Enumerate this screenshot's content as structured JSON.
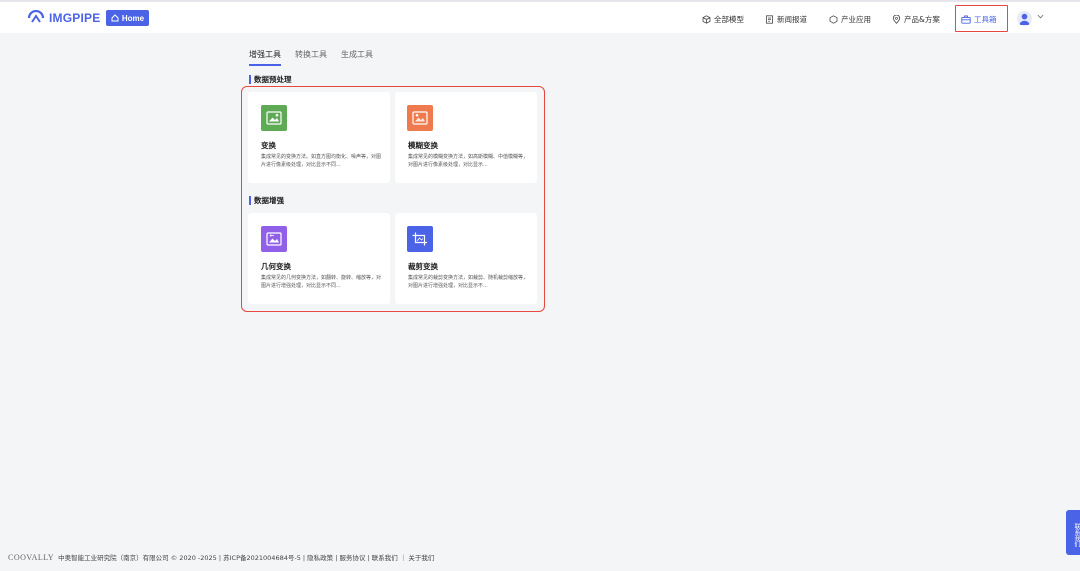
{
  "header": {
    "logo_text": "IMGPIPE",
    "home_label": "Home",
    "nav": [
      {
        "label": "全部模型",
        "icon": "cube-icon"
      },
      {
        "label": "新闻报道",
        "icon": "document-icon"
      },
      {
        "label": "产业应用",
        "icon": "hexagon-icon"
      },
      {
        "label": "产品&方案",
        "icon": "location-pin-icon"
      },
      {
        "label": "工具箱",
        "icon": "toolbox-icon",
        "active": true
      }
    ]
  },
  "tabs": [
    {
      "label": "增强工具",
      "active": true
    },
    {
      "label": "转换工具",
      "active": false
    },
    {
      "label": "生成工具",
      "active": false
    }
  ],
  "sections": [
    {
      "title": "数据预处理",
      "cards": [
        {
          "title": "变换",
          "desc": "集成常见的变换方法。如直方图均衡化、噪声等，对图片进行像素级处理，对比显示不同...",
          "color": "#5faa55"
        },
        {
          "title": "模糊变换",
          "desc": "集成常见的模糊变换方法，如高斯模糊、中值模糊等，对图片进行像素级处理，对比显示...",
          "color": "#ee7a4d"
        }
      ]
    },
    {
      "title": "数据增强",
      "cards": [
        {
          "title": "几何变换",
          "desc": "集成常见的几何变换方法，如翻转、旋转、缩放等，对图片进行增强处理，对比显示不同...",
          "color": "#9061e8"
        },
        {
          "title": "裁剪变换",
          "desc": "集成常见的裁剪变换方法，如裁剪、随机裁剪缩放等，对图片进行增强处理，对比显示不...",
          "color": "#4a63e7"
        }
      ]
    }
  ],
  "footer": {
    "brand": "COOVALLY",
    "text": "中奥智能工业研究院（南京）有限公司 © 2020 -2025 | 苏ICP备2021004684号-5 | 隐私政策 | 服务协议 | 联系我们 ｜ 关于我们"
  },
  "contact_label": "联系我们",
  "colors": {
    "accent": "#4a63e7",
    "highlight": "#e5483f"
  }
}
